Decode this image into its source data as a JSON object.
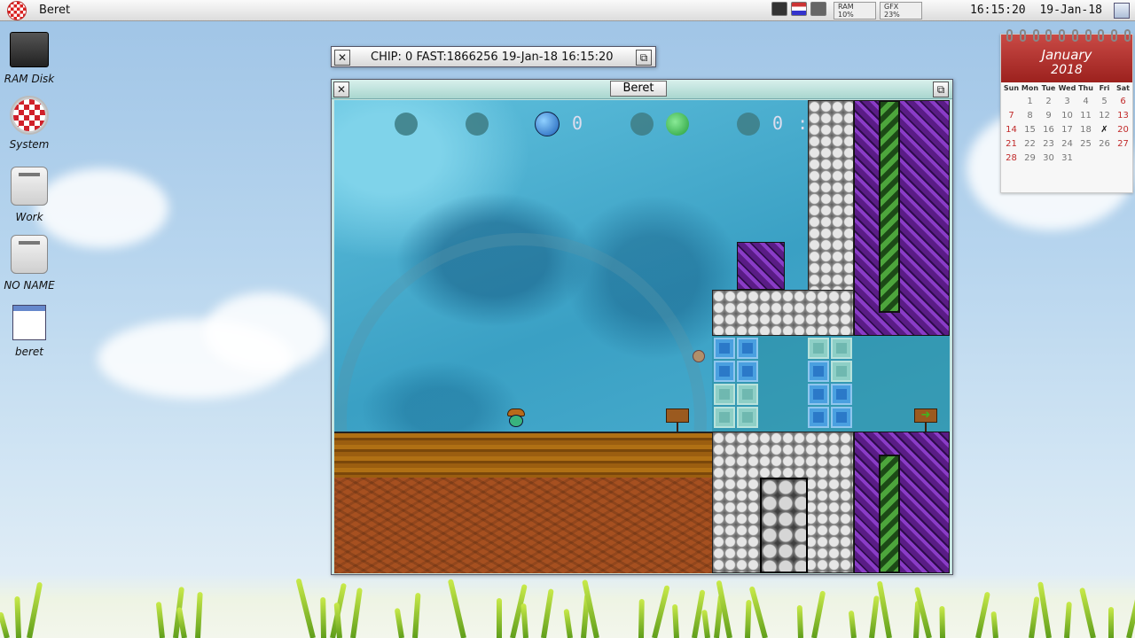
{
  "menubar": {
    "title": "Beret",
    "ram_label": "RAM",
    "ram_value": "10%",
    "gfx_label": "GFX",
    "gfx_value": "23%",
    "time": "16:15:20",
    "date": "19-Jan-18"
  },
  "desktop": {
    "icons": [
      {
        "label": "RAM Disk"
      },
      {
        "label": "System"
      },
      {
        "label": "Work"
      },
      {
        "label": "NO NAME"
      },
      {
        "label": "beret"
      }
    ]
  },
  "chip_window": {
    "text": "CHIP:   0 FAST:1866256 19-Jan-18 16:15:20"
  },
  "game_window": {
    "title": "Beret",
    "hud": {
      "score": "0",
      "timer": "0 : 38"
    }
  },
  "calendar": {
    "month": "January",
    "year": "2018",
    "days_of_week": [
      "Sun",
      "Mon",
      "Tue",
      "Wed",
      "Thu",
      "Fri",
      "Sat"
    ],
    "weeks": [
      [
        "",
        "1",
        "2",
        "3",
        "4",
        "5",
        "6"
      ],
      [
        "7",
        "8",
        "9",
        "10",
        "11",
        "12",
        "13"
      ],
      [
        "14",
        "15",
        "16",
        "17",
        "18",
        "19",
        "20"
      ],
      [
        "21",
        "22",
        "23",
        "24",
        "25",
        "26",
        "27"
      ],
      [
        "28",
        "29",
        "30",
        "31",
        "",
        "",
        ""
      ]
    ],
    "today": "19",
    "today_mark": "✗"
  }
}
